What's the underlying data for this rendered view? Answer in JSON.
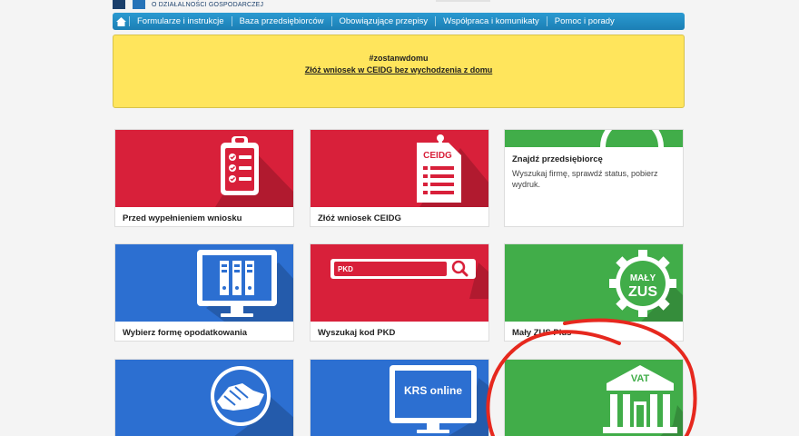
{
  "header": {
    "logo_text": "O DZIAŁALNOŚCI GOSPODARCZEJ"
  },
  "nav": {
    "items": [
      {
        "label": "Formularze i instrukcje"
      },
      {
        "label": "Baza przedsiębiorców"
      },
      {
        "label": "Obowiązujące przepisy"
      },
      {
        "label": "Współpraca i komunikaty"
      },
      {
        "label": "Pomoc i porady"
      }
    ]
  },
  "banner": {
    "hashtag": "#zostanwdomu",
    "link": "Złóż wniosek w CEIDG bez wychodzenia z domu"
  },
  "tiles": [
    {
      "title": "Przed wypełnieniem wniosku",
      "icon": "clipboard-checklist-icon",
      "color": "#d8203a"
    },
    {
      "title": "Złóż wniosek CEIDG",
      "icon": "ceidg-document-icon",
      "icon_text": "CEIDG",
      "color": "#d8203a"
    },
    {
      "title": "Znajdź przedsiębiorcę",
      "desc": "Wyszukaj firmę, sprawdź status, pobierz wydruk.",
      "icon": "search-globe-icon",
      "color": "#41ad49"
    },
    {
      "title": "Wybierz formę opodatkowania",
      "icon": "monitor-binders-icon",
      "color": "#2c6fd1"
    },
    {
      "title": "Wyszukaj kod PKD",
      "icon": "pkd-search-icon",
      "icon_text": "PKD",
      "color": "#d8203a"
    },
    {
      "title": "Mały ZUS Plus",
      "icon": "maly-zus-gear-icon",
      "icon_text_1": "MAŁY",
      "icon_text_2": "ZUS",
      "color": "#41ad49"
    },
    {
      "title": "",
      "icon": "handshake-icon",
      "color": "#2c6fd1"
    },
    {
      "title": "",
      "icon": "krs-online-monitor-icon",
      "icon_text": "KRS online",
      "color": "#2c6fd1"
    },
    {
      "title": "",
      "icon": "vat-building-icon",
      "icon_text": "VAT",
      "color": "#41ad49"
    }
  ],
  "annotation": {
    "color": "#e6281e"
  }
}
